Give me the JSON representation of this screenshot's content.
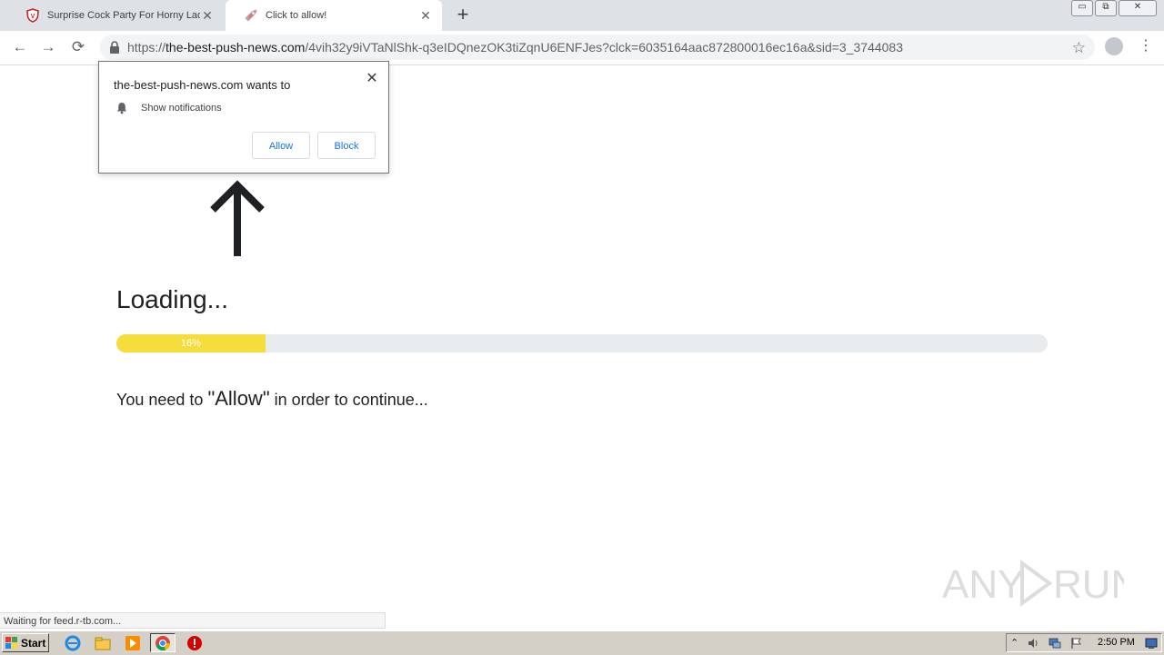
{
  "browser": {
    "tabs": [
      {
        "title": "Surprise Cock Party For Horny Ladies",
        "active": false,
        "favicon": "shield-icon"
      },
      {
        "title": "Click to allow!",
        "active": true,
        "favicon": "rocket-icon"
      }
    ],
    "new_tab_label": "+",
    "window_buttons": {
      "minimize": "▭",
      "restore": "⧉",
      "close": "✕"
    },
    "url": {
      "scheme": "https://",
      "host": "the-best-push-news.com",
      "path": "/4vih32y9iVTaNlShk-q3eIDQnezOK3tiZqnU6ENFJes?clck=6035164aac872800016ec16a&sid=3_3744083"
    }
  },
  "permission_popup": {
    "title": "the-best-push-news.com wants to",
    "permission": "Show notifications",
    "allow_label": "Allow",
    "block_label": "Block"
  },
  "page": {
    "loading_text": "Loading...",
    "progress_percent": 16,
    "progress_label": "16%",
    "message_prefix": "You need to ",
    "message_highlight": "\"Allow\"",
    "message_suffix": " in order to continue..."
  },
  "status_bar": {
    "text": "Waiting for feed.r-tb.com..."
  },
  "watermark": {
    "text": "ANY RUN"
  },
  "taskbar": {
    "start_label": "Start",
    "clock": "2:50 PM"
  },
  "colors": {
    "progress_fill": "#f5dd3b",
    "progress_track": "#e9ecef",
    "button_text": "#1a73e8"
  }
}
